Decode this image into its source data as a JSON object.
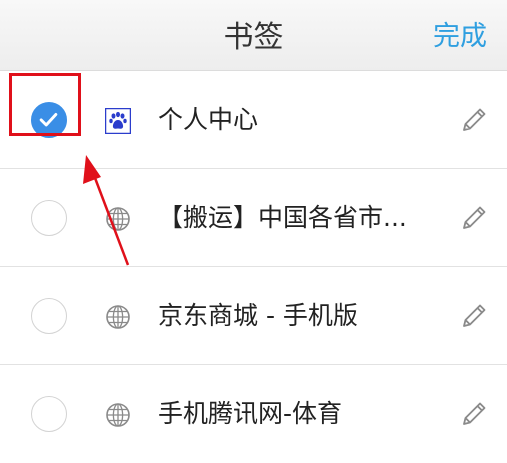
{
  "header": {
    "title": "书签",
    "done_label": "完成"
  },
  "bookmarks": [
    {
      "label": "个人中心",
      "checked": true,
      "icon": "baidu-paw-icon"
    },
    {
      "label": "【搬运】中国各省市...",
      "checked": false,
      "icon": "globe-icon"
    },
    {
      "label": "京东商城 - 手机版",
      "checked": false,
      "icon": "globe-icon"
    },
    {
      "label": "手机腾讯网-体育",
      "checked": false,
      "icon": "globe-icon"
    }
  ],
  "colors": {
    "accent": "#2f9fe0",
    "check_on": "#3a8ee6",
    "annotation": "#e0101a"
  }
}
